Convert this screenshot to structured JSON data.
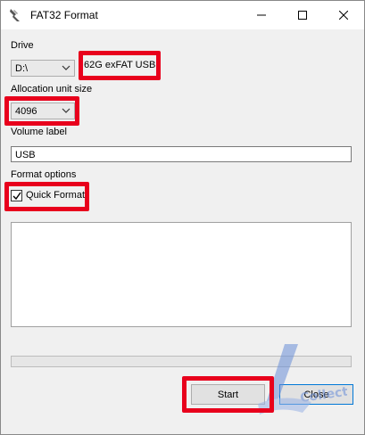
{
  "window": {
    "title": "FAT32 Format",
    "icon": "app-icon",
    "controls": {
      "minimize": "—",
      "maximize": "☐",
      "close": "✕"
    }
  },
  "drive": {
    "label": "Drive",
    "selected": "D:\\",
    "info": "62G exFAT USB"
  },
  "allocation": {
    "label": "Allocation unit size",
    "selected": "4096"
  },
  "volume": {
    "label": "Volume label",
    "value": "USB"
  },
  "format_options": {
    "label": "Format options",
    "quick_format_label": "Quick Format",
    "quick_format_checked": true
  },
  "progress": {
    "value": 0
  },
  "buttons": {
    "start": "Start",
    "close": "Close"
  },
  "colors": {
    "highlight": "#e8001c",
    "focus_border": "#0078d7"
  }
}
